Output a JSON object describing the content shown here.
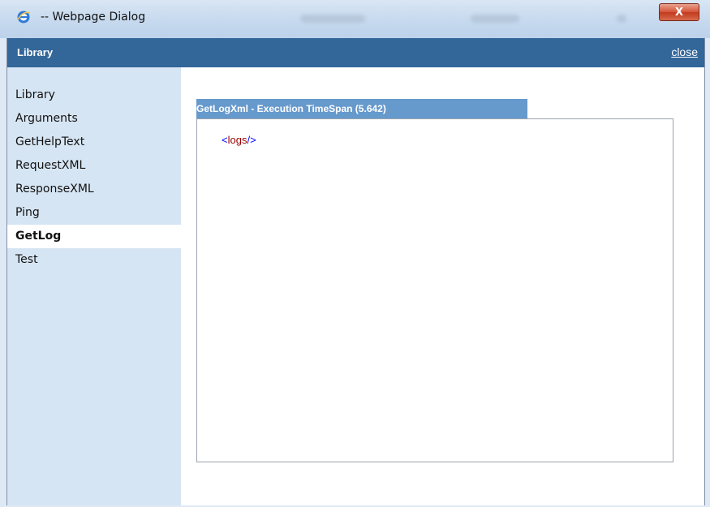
{
  "window": {
    "title": "-- Webpage Dialog",
    "close_glyph": "X",
    "icon": "ie-icon"
  },
  "header": {
    "title": "Library",
    "close_label": "close",
    "color": "#336699"
  },
  "sidebar": {
    "items": [
      {
        "label": "Library",
        "active": false
      },
      {
        "label": "Arguments",
        "active": false
      },
      {
        "label": "GetHelpText",
        "active": false
      },
      {
        "label": "RequestXML",
        "active": false
      },
      {
        "label": "ResponseXML",
        "active": false
      },
      {
        "label": "Ping",
        "active": false
      },
      {
        "label": "GetLog",
        "active": true
      },
      {
        "label": "Test",
        "active": false
      }
    ],
    "background": "#d6e5f3"
  },
  "panel": {
    "title": "GetLogXml - Execution TimeSpan (5.642)",
    "header_color": "#6699cc",
    "xml": {
      "open": "<",
      "tag": "logs",
      "close": "/>"
    }
  }
}
